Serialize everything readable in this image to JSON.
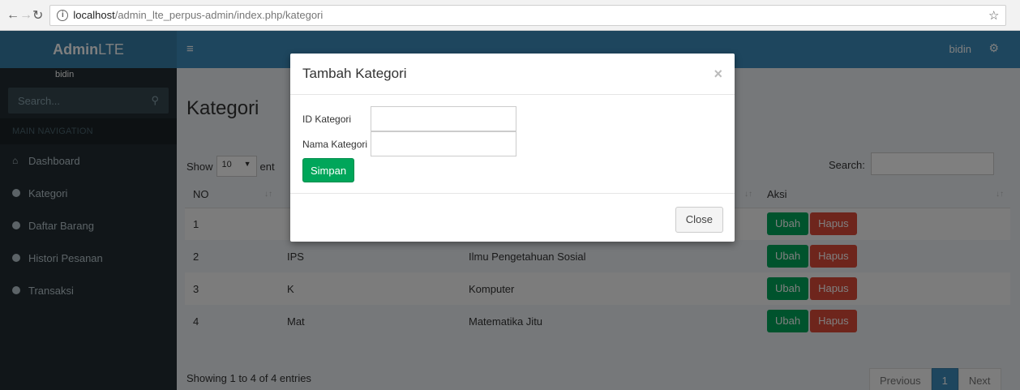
{
  "browser": {
    "back_icon": "arrow-left-icon",
    "forward_icon": "arrow-right-icon",
    "reload_icon": "reload-icon",
    "url_host": "localhost",
    "url_path": "/admin_lte_perpus-admin/index.php/kategori",
    "star_icon": "star-icon",
    "menu_icon": "kebab-icon"
  },
  "header": {
    "logo_bold": "Admin",
    "logo_light": "LTE",
    "user_name": "bidin",
    "brand_color": "#3c8dbc"
  },
  "sidebar": {
    "user_partial": "bidin",
    "search_placeholder": "Search...",
    "nav_header": "MAIN NAVIGATION",
    "items": [
      {
        "label": "Dashboard",
        "icon": "home-icon"
      },
      {
        "label": "Kategori",
        "icon": "circle-icon"
      },
      {
        "label": "Daftar Barang",
        "icon": "circle-icon"
      },
      {
        "label": "Histori Pesanan",
        "icon": "circle-icon"
      },
      {
        "label": "Transaksi",
        "icon": "circle-icon"
      }
    ]
  },
  "page": {
    "title": "Kategori",
    "show_label": "Show",
    "length_value": "10",
    "entries_partial": "ent",
    "search_label": "Search:",
    "columns": [
      "NO",
      "",
      "",
      "Aksi"
    ],
    "rows": [
      {
        "no": "1",
        "id": "",
        "nama": ""
      },
      {
        "no": "2",
        "id": "IPS",
        "nama": "Ilmu Pengetahuan Sosial"
      },
      {
        "no": "3",
        "id": "K",
        "nama": "Komputer"
      },
      {
        "no": "4",
        "id": "Mat",
        "nama": "Matematika Jitu"
      }
    ],
    "edit_label": "Ubah",
    "delete_label": "Hapus",
    "info": "Showing 1 to 4 of 4 entries",
    "pager": {
      "previous": "Previous",
      "current": "1",
      "next": "Next"
    }
  },
  "modal": {
    "title": "Tambah Kategori",
    "close_x": "×",
    "field_id_label": "ID Kategori",
    "field_nama_label": "Nama Kategori",
    "save_label": "Simpan",
    "close_label": "Close"
  }
}
